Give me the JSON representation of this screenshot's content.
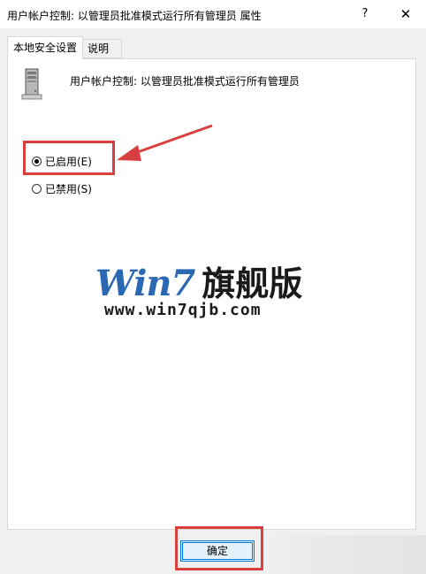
{
  "window": {
    "title": "用户帐户控制: 以管理员批准模式运行所有管理员 属性",
    "help_label": "?",
    "close_label": "✕"
  },
  "tabs": [
    {
      "label": "本地安全设置",
      "active": true
    },
    {
      "label": "说明",
      "active": false
    }
  ],
  "policy": {
    "icon": "server-computer-icon",
    "name": "用户帐户控制: 以管理员批准模式运行所有管理员"
  },
  "options": [
    {
      "label": "已启用(E)",
      "selected": true
    },
    {
      "label": "已禁用(S)",
      "selected": false
    }
  ],
  "watermark": {
    "logo_text": "Win7",
    "logo_cn": "旗舰版",
    "url": "www.win7qjb.com"
  },
  "buttons": {
    "ok_label": "确定"
  },
  "colors": {
    "highlight": "#d84040",
    "accent": "#0078d7",
    "watermark_blue": "#2a68b3"
  }
}
